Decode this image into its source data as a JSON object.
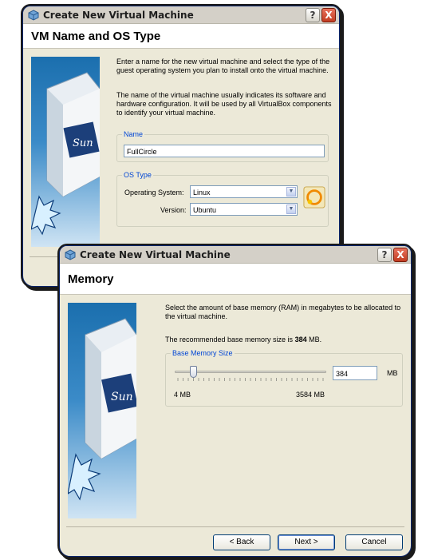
{
  "window1": {
    "title": "Create New Virtual Machine",
    "page_title": "VM Name and OS Type",
    "intro": "Enter a name for the new virtual machine and select the type of the guest operating system you plan to install onto the virtual machine.",
    "note": "The name of the virtual machine usually indicates its software and hardware configuration. It will be used by all VirtualBox components to identify your virtual machine.",
    "name_group": {
      "legend": "Name",
      "value": "FullCircle"
    },
    "os_group": {
      "legend": "OS Type",
      "os_label": "Operating System:",
      "os_value": "Linux",
      "version_label": "Version:",
      "version_value": "Ubuntu"
    },
    "help_label": "?",
    "close_label": "X"
  },
  "window2": {
    "title": "Create New Virtual Machine",
    "page_title": "Memory",
    "intro": "Select the amount of base memory (RAM) in megabytes to be allocated to the virtual machine.",
    "recommend_prefix": "The recommended base memory size is",
    "recommend_value": "384",
    "recommend_suffix": "MB.",
    "memory_group": {
      "legend": "Base Memory Size",
      "value": "384",
      "unit": "MB",
      "min_label": "4 MB",
      "max_label": "3584 MB",
      "slider_fraction": 0.106
    },
    "buttons": {
      "back": "< Back",
      "next": "Next >",
      "cancel": "Cancel"
    },
    "help_label": "?",
    "close_label": "X"
  },
  "colors": {
    "legend_blue": "#0046d5",
    "titlebar": "#d4d0c8",
    "dialog_bg": "#ece9d8"
  }
}
